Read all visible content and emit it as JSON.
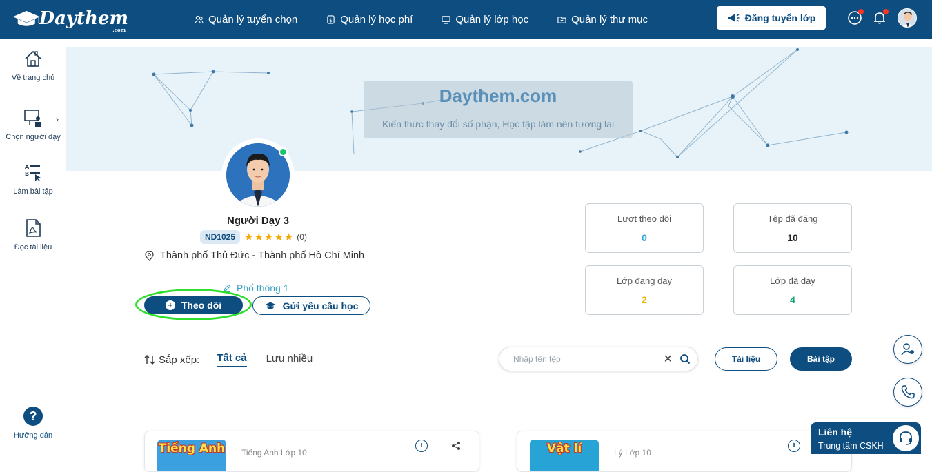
{
  "header": {
    "logo_text": "Daythem",
    "logo_sub": ".com",
    "nav": [
      {
        "label": "Quản lý tuyển chọn",
        "icon": "users-icon"
      },
      {
        "label": "Quản lý học phí",
        "icon": "money-icon"
      },
      {
        "label": "Quản lý lớp học",
        "icon": "classroom-icon"
      },
      {
        "label": "Quản lý thư mục",
        "icon": "folder-icon"
      }
    ],
    "post_button": "Đăng tuyển lớp"
  },
  "sidebar": {
    "items": [
      {
        "label": "Về trang chủ",
        "icon": "home-icon"
      },
      {
        "label": "Chọn người dạy",
        "icon": "teacher-icon"
      },
      {
        "label": "Làm bài tập",
        "icon": "exercise-icon"
      },
      {
        "label": "Đọc tài liệu",
        "icon": "pdf-icon"
      }
    ],
    "arrow": "›",
    "help_label": "Hướng dẫn",
    "help_symbol": "?"
  },
  "banner": {
    "title": "Daythem.com",
    "subtitle": "Kiến thức thay đổi số phận, Học tập làm nên tương lai"
  },
  "profile": {
    "name": "Người Dạy 3",
    "code": "ND1025",
    "stars": "★★★★★",
    "rating_count": "(0)",
    "location": "Thành phố Thủ Đức - Thành phố Hồ Chí Minh",
    "grade": "Phổ thông 1",
    "follow_button": "Theo dõi",
    "request_button": "Gửi yêu cầu học"
  },
  "stats": [
    {
      "label": "Lượt theo dõi",
      "value": "0",
      "color": "#2aa7d8"
    },
    {
      "label": "Tệp đã đăng",
      "value": "10",
      "color": "#222222"
    },
    {
      "label": "Lớp đang dạy",
      "value": "2",
      "color": "#f0b400"
    },
    {
      "label": "Lớp đã dạy",
      "value": "4",
      "color": "#1aa37a"
    }
  ],
  "filter": {
    "sort_label": "Sắp xếp:",
    "tabs": [
      "Tất cả",
      "Lưu nhiều"
    ],
    "active_tab": "Tất cả",
    "search_placeholder": "Nhập tên tệp",
    "clear_symbol": "✕",
    "doc_button": "Tài liệu",
    "exercise_button": "Bài tập"
  },
  "cards": [
    {
      "thumb_title": "Tiếng Anh",
      "subtitle": "Tiếng Anh Lớp 10",
      "thumb_color": "#3aa0e0"
    },
    {
      "thumb_title": "Vật lí",
      "subtitle": "Lý Lớp 10",
      "thumb_color": "#27a3d6"
    }
  ],
  "contact": {
    "title": "Liên hệ",
    "subtitle": "Trung tâm CSKH"
  },
  "colors": {
    "primary": "#0e4d80",
    "highlight": "#2ee02b",
    "online": "#19c36b",
    "star": "#f5a800"
  }
}
